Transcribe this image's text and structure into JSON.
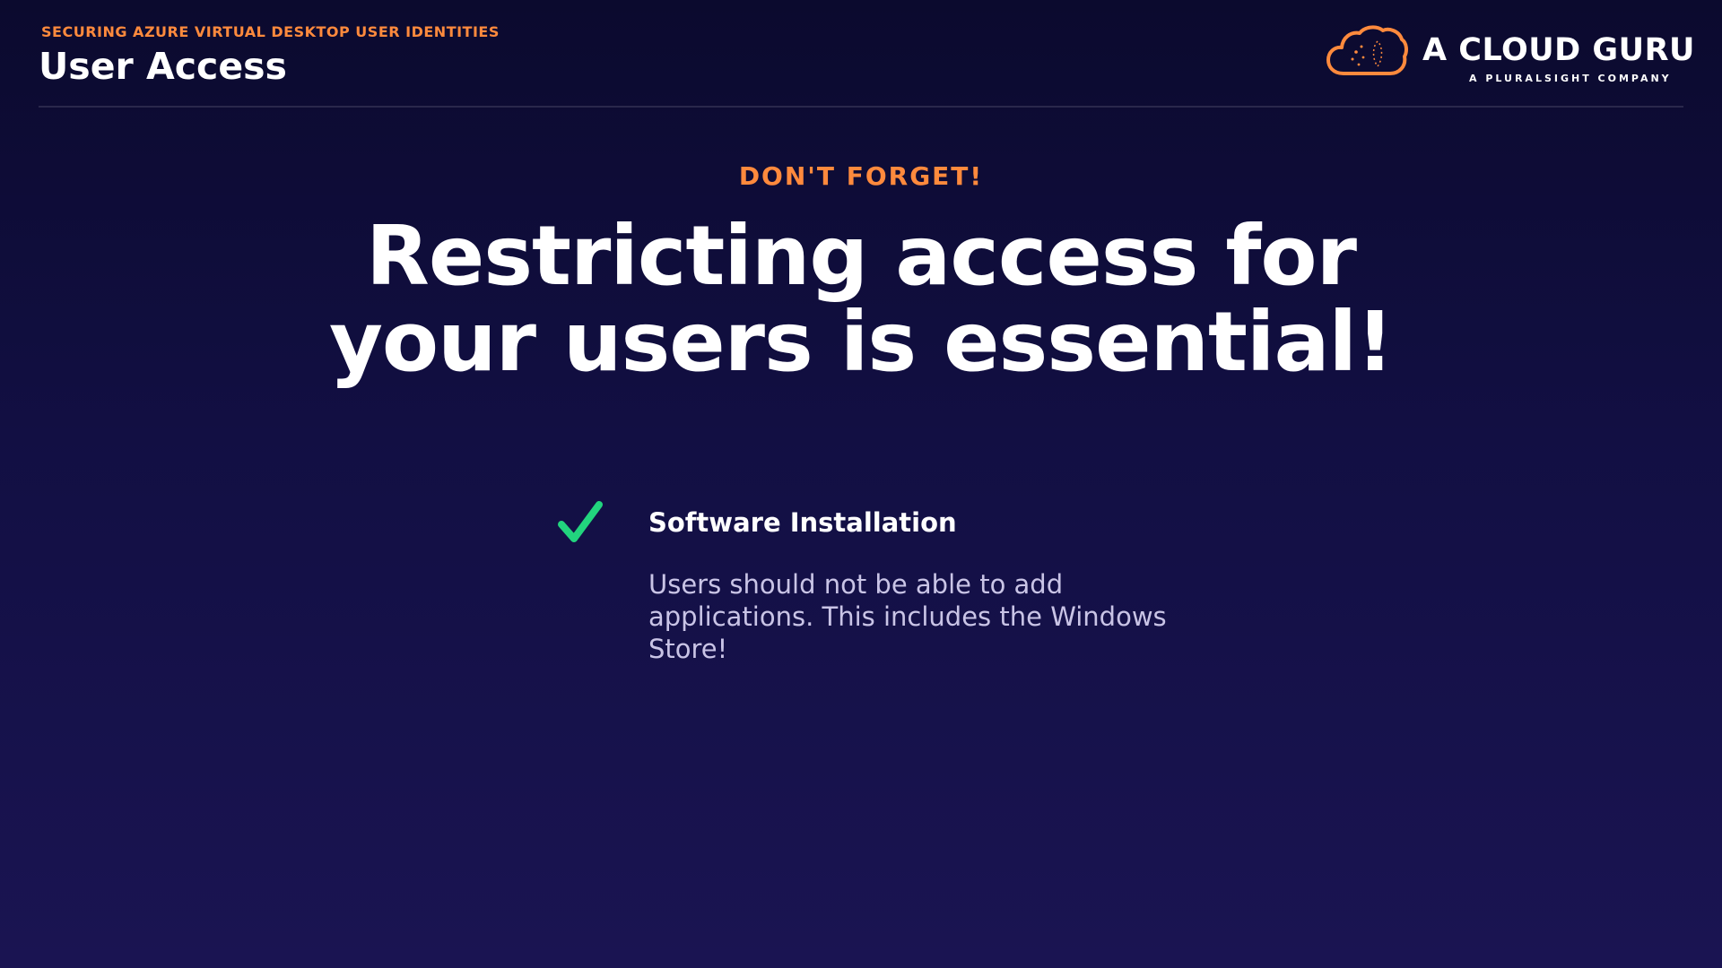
{
  "header": {
    "kicker": "SECURING AZURE VIRTUAL DESKTOP USER IDENTITIES",
    "title": "User Access"
  },
  "logo": {
    "icon": "cloud-logo-icon",
    "wordmark": "A CLOUD GURU",
    "tagline": "A PLURALSIGHT COMPANY"
  },
  "main": {
    "eyebrow": "DON'T FORGET!",
    "headline_line1": "Restricting access for",
    "headline_line2": "your users is essential!",
    "items": [
      {
        "icon": "checkmark-icon",
        "title": "Software Installation",
        "description": "Users should not be able to add applications. This includes the Windows Store!"
      }
    ]
  },
  "colors": {
    "accent": "#ff8a3d",
    "check": "#22d47e",
    "background_top": "#0b0a2e",
    "background_bottom": "#1a1452",
    "body_text": "#c9c4e6"
  }
}
